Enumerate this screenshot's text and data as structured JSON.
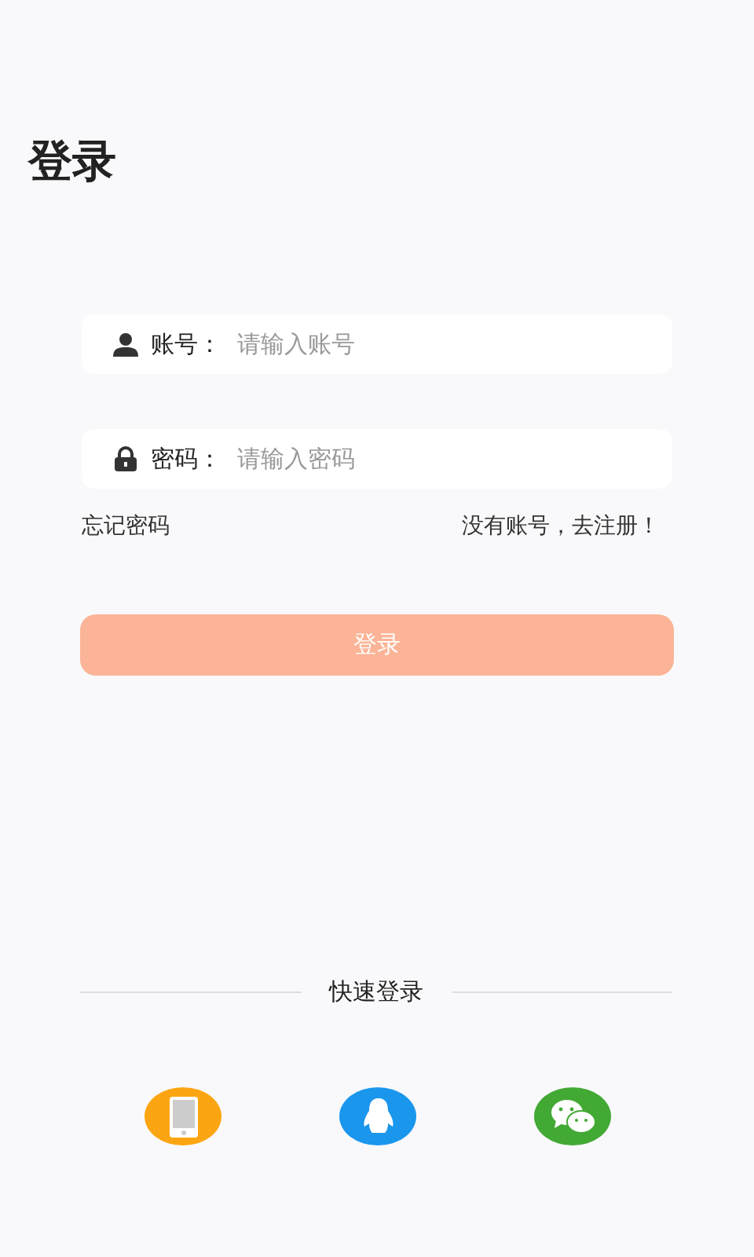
{
  "title": "登录",
  "fields": [
    {
      "kind": "user",
      "label": "账号：",
      "placeholder": "请输入账号"
    },
    {
      "kind": "lock",
      "label": "密码：",
      "placeholder": "请输入密码"
    }
  ],
  "links": [
    "忘记密码",
    "没有账号，去注册！"
  ],
  "login_button": "登录",
  "quick_login": {
    "title": "快速登录",
    "options": [
      {
        "kind": "phone",
        "color": "#fca512"
      },
      {
        "kind": "qq",
        "color": "#1a96ed"
      },
      {
        "kind": "wechat",
        "color": "#43a935"
      }
    ]
  }
}
